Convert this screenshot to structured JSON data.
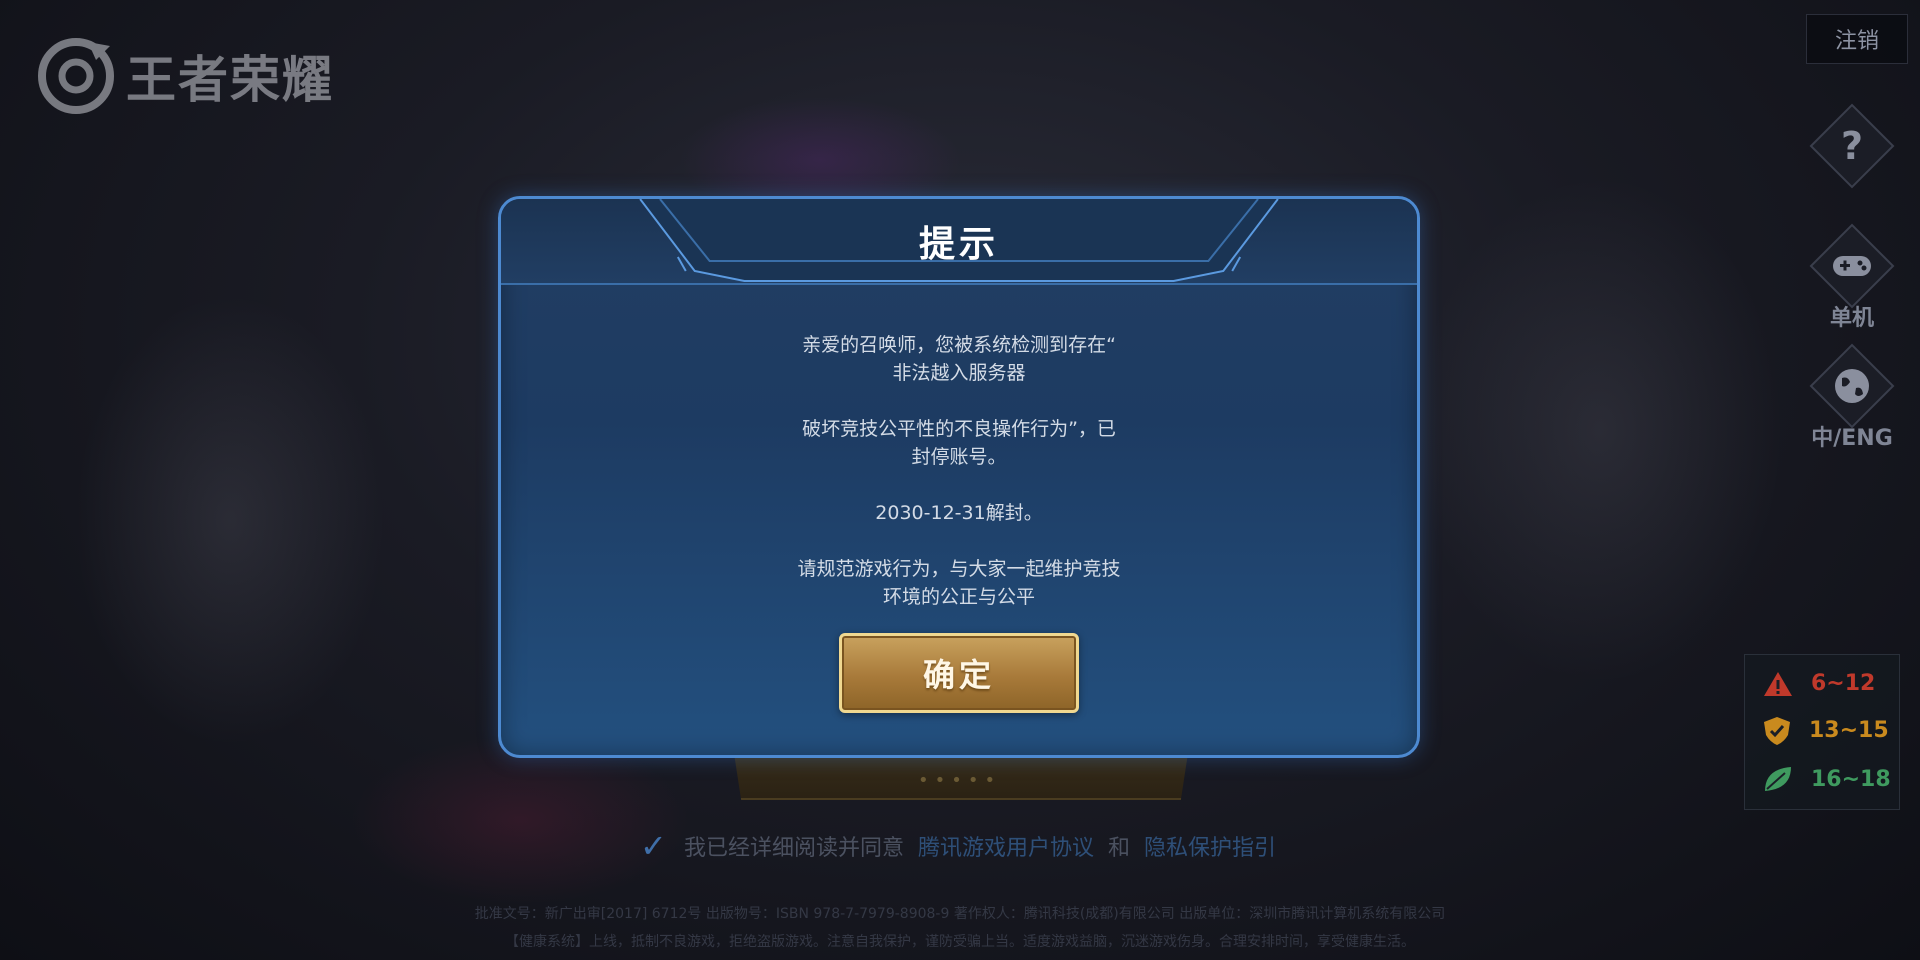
{
  "app": {
    "logo_text": "王者荣耀"
  },
  "topbar": {
    "logout_label": "注销"
  },
  "side": {
    "help_icon": "question-icon",
    "single_label": "单机",
    "lang_label": "中/ENG"
  },
  "age_ratings": [
    {
      "label": "6~12",
      "icon": "warning-icon",
      "color": "#c0392b"
    },
    {
      "label": "13~15",
      "icon": "shield-icon",
      "color": "#c98a1e"
    },
    {
      "label": "16~18",
      "icon": "leaf-icon",
      "color": "#3f9a5f"
    }
  ],
  "agreement": {
    "prefix": "我已经详细阅读并同意",
    "link1": "腾讯游戏用户协议",
    "conj": "和",
    "link2": "隐私保护指引"
  },
  "footer": {
    "line1": "批准文号：新广出审[2017] 6712号  出版物号：ISBN 978-7-7979-8908-9  著作权人：腾讯科技(成都)有限公司  出版单位：深圳市腾讯计算机系统有限公司",
    "line2": "【健康系统】上线，抵制不良游戏，拒绝盗版游戏。注意自我保护，谨防受骗上当。适度游戏益脑，沉迷游戏伤身。合理安排时间，享受健康生活。"
  },
  "dialog": {
    "title": "提示",
    "line1": "亲爱的召唤师，您被系统检测到存在“",
    "line2": "非法越入服务器",
    "line3": "破坏竞技公平性的不良操作行为”，已",
    "line4": "封停账号。",
    "line5": "2030-12-31解封。",
    "line6": "请规范游戏行为，与大家一起维护竞技",
    "line7": "环境的公正与公平",
    "confirm_label": "确定"
  }
}
